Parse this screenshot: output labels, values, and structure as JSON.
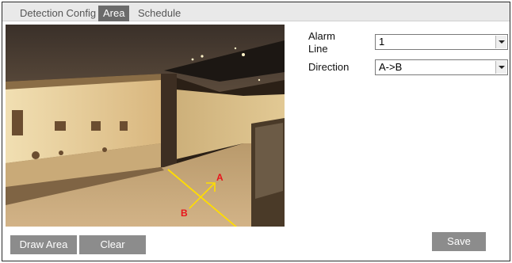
{
  "tabs": [
    {
      "label": "Detection Config",
      "active": false
    },
    {
      "label": "Area",
      "active": true
    },
    {
      "label": "Schedule",
      "active": false
    }
  ],
  "video": {
    "line_color": "#ffdd00",
    "label_color": "#e8141b",
    "direction_labels": {
      "a": "A",
      "b": "B"
    }
  },
  "form": {
    "alarm_line_label": "Alarm Line",
    "alarm_line_value": "1",
    "direction_label": "Direction",
    "direction_value": "A->B"
  },
  "buttons": {
    "draw_area": "Draw Area",
    "clear": "Clear",
    "save": "Save"
  },
  "colors": {
    "tab_active_bg": "#6b6b6b",
    "button_bg": "#8c8c8c"
  }
}
